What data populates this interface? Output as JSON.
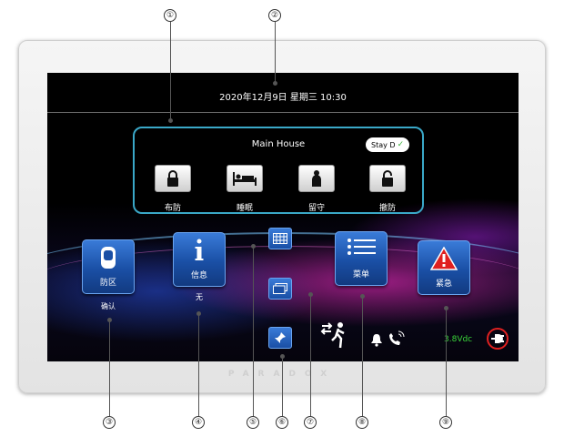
{
  "callouts": [
    "①",
    "②",
    "③",
    "④",
    "⑤",
    "⑥",
    "⑦",
    "⑧",
    "⑨"
  ],
  "header": {
    "datetime": "2020年12月9日 星期三 10:30"
  },
  "area": {
    "name": "Main House",
    "status_badge": "Stay D",
    "status_check": "✓",
    "buttons": [
      {
        "label": "布防",
        "icon": "lock-closed-icon"
      },
      {
        "label": "睡眠",
        "icon": "bed-icon"
      },
      {
        "label": "留守",
        "icon": "person-icon"
      },
      {
        "label": "撤防",
        "icon": "lock-open-icon"
      }
    ]
  },
  "tiles": {
    "zones": {
      "label": "防区",
      "sub": "确认",
      "icon": "sensor-icon"
    },
    "info": {
      "label": "信息",
      "sub": "无",
      "icon": "info-icon"
    },
    "menu": {
      "label": "菜单",
      "icon": "menu-list-icon"
    },
    "panic": {
      "label": "紧急",
      "icon": "warning-icon"
    }
  },
  "small_buttons": [
    {
      "icon": "keypad-grid-icon"
    },
    {
      "icon": "screens-icon"
    },
    {
      "icon": "pin-icon"
    }
  ],
  "status": {
    "exit_icon": "exit-running-man-icon",
    "bell_icon": "bell-icon",
    "phone_icon": "phone-icon",
    "voltage": "3.8Vdc",
    "power_icon": "ac-power-plug-icon"
  },
  "brand": "PARADOX",
  "colors": {
    "panel_border": "#3aa8c8",
    "tile_blue": "#1a4fa5",
    "voltage_green": "#3ad63a",
    "alert_red": "#e02020"
  }
}
